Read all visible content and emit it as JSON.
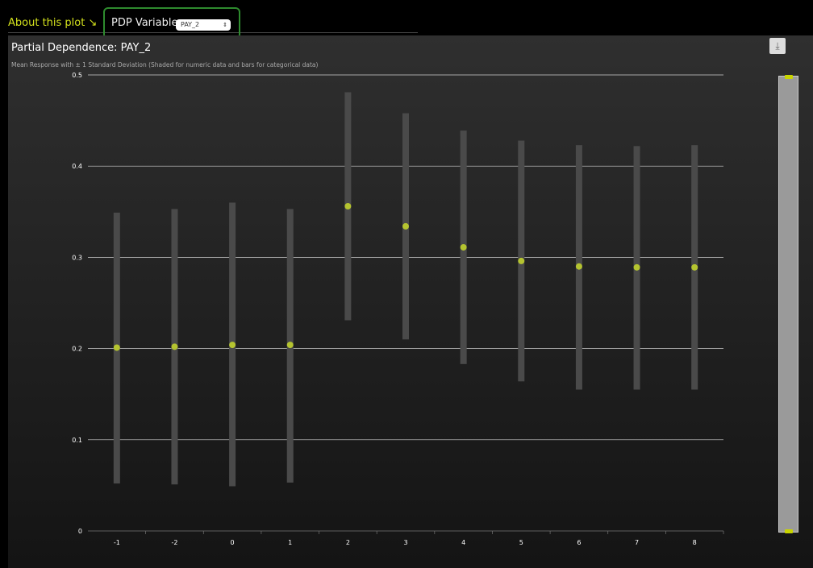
{
  "header": {
    "about_link": "About this plot ↘",
    "pdp_label": "PDP Variable:",
    "pdp_selected": "PAY_2"
  },
  "chart_data": {
    "type": "scatter",
    "title": "Partial Dependence: PAY_2",
    "subtitle": "Mean Response with ± 1 Standard Deviation (Shaded for numeric data and bars for categorical data)",
    "categories": [
      "-1",
      "-2",
      "0",
      "1",
      "2",
      "3",
      "4",
      "5",
      "6",
      "7",
      "8"
    ],
    "mean": [
      0.201,
      0.202,
      0.204,
      0.204,
      0.356,
      0.334,
      0.311,
      0.296,
      0.29,
      0.289,
      0.289
    ],
    "upper": [
      0.349,
      0.353,
      0.36,
      0.353,
      0.481,
      0.458,
      0.439,
      0.428,
      0.423,
      0.422,
      0.423
    ],
    "lower": [
      0.052,
      0.051,
      0.049,
      0.053,
      0.231,
      0.21,
      0.183,
      0.164,
      0.155,
      0.155,
      0.155
    ],
    "ylim": [
      0,
      0.5
    ],
    "yticks": [
      "0",
      "0.1",
      "0.2",
      "0.3",
      "0.4",
      "0.5"
    ],
    "grid": true,
    "colors": {
      "point": "#b5c430",
      "bar": "#4a4a4a",
      "grid": "#cfcfcf"
    }
  }
}
